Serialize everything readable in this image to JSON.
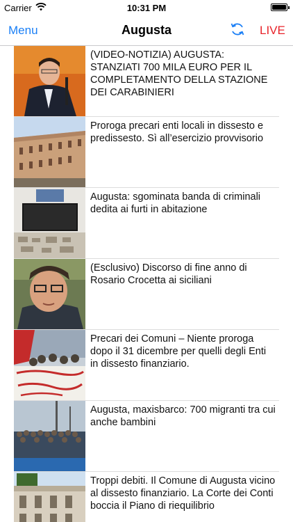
{
  "status_bar": {
    "carrier": "Carrier",
    "time": "10:31 PM"
  },
  "nav": {
    "menu_label": "Menu",
    "title": "Augusta",
    "live_label": "LIVE",
    "refresh_icon": "refresh-icon"
  },
  "colors": {
    "accent_blue": "#1a7ff6",
    "live_red": "#e8232a"
  },
  "news": [
    {
      "headline": "(VIDEO-NOTIZIA) AUGUSTA: STANZIATI 700 MILA EURO PER IL COMPLETAMENTO DELLA STAZIONE DEI CARABINIERI"
    },
    {
      "headline": "Proroga precari enti locali in dissesto e predissesto. Sì all’esercizio provvisorio"
    },
    {
      "headline": "Augusta: sgominata banda di criminali dedita ai furti in abitazione"
    },
    {
      "headline": "(Esclusivo) Discorso di fine anno di Rosario Crocetta ai siciliani"
    },
    {
      "headline": "Precari dei Comuni – Niente proroga dopo il 31 dicembre per quelli degli Enti in dissesto finanziario."
    },
    {
      "headline": "Augusta, maxisbarco: 700 migranti tra cui anche bambini"
    },
    {
      "headline": "Troppi debiti. Il Comune di Augusta vicino al dissesto finanziario. La Corte dei Conti boccia il Piano di riequilibrio"
    }
  ]
}
